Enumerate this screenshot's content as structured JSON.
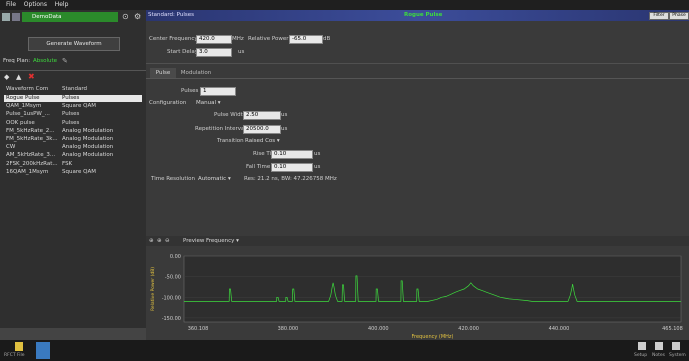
{
  "menu": {
    "items": [
      "File",
      "Options",
      "Help"
    ]
  },
  "left": {
    "project_name": "DemoData",
    "generate_label": "Generate Waveform",
    "freq_plan_label": "Freq Plan:",
    "freq_plan_value": "Absolute",
    "columns": [
      "Waveform Com",
      "Standard"
    ],
    "waveforms": [
      {
        "name": "Rogue Pulse",
        "standard": "Pulses",
        "selected": true
      },
      {
        "name": "QAM_1Msym",
        "standard": "Square QAM"
      },
      {
        "name": "Pulse_1usPW_...",
        "standard": "Pulses"
      },
      {
        "name": "OOK pulse",
        "standard": "Pulses"
      },
      {
        "name": "FM_5kHzRate_2...",
        "standard": "Analog Modulation"
      },
      {
        "name": "FM_5kHzRate_3k...",
        "standard": "Analog Modulation"
      },
      {
        "name": "CW",
        "standard": "Analog Modulation"
      },
      {
        "name": "AM_5kHzRate_3...",
        "standard": "Analog Modulation"
      },
      {
        "name": "2FSK_200kHzRat...",
        "standard": "FSK"
      },
      {
        "name": "16QAM_1Msym",
        "standard": "Square QAM"
      }
    ]
  },
  "header": {
    "standard_label": "Standard: Pulses",
    "waveform_title": "Rogue Pulse",
    "filter_button": "Filter",
    "phase_button": "Phase"
  },
  "params": {
    "center_freq_label": "Center Frequency",
    "center_freq_value": "420.0",
    "center_freq_unit": "MHz",
    "rel_power_label": "Relative Power",
    "rel_power_value": "-65.0",
    "rel_power_unit": "dB",
    "start_delay_label": "Start Delay",
    "start_delay_value": "3.0",
    "start_delay_unit": "us"
  },
  "tabs": [
    "Pulse",
    "Modulation"
  ],
  "pulse": {
    "pulses_label": "Pulses",
    "pulses_value": "1",
    "config_label": "Configuration",
    "config_value": "Manual",
    "pulse_width_label": "Pulse Width",
    "pulse_width_value": "2.50",
    "pulse_width_unit": "us",
    "rep_interval_label": "Repetition Interval",
    "rep_interval_value": "20500.0",
    "rep_interval_unit": "us",
    "transition_label": "Transition",
    "transition_value": "Raised Cos",
    "rise_label": "Rise Time",
    "rise_value": "0.10",
    "rise_unit": "us",
    "fall_label": "Fall Time",
    "fall_value": "0.10",
    "fall_unit": "us",
    "time_res_label": "Time Resolution",
    "time_res_value": "Automatic",
    "res_text": "Res: 21.2 ns, BW: 47.226758 MHz"
  },
  "preview": {
    "label": "Preview",
    "mode": "Frequency"
  },
  "chart_data": {
    "type": "line",
    "xlabel": "Frequency (MHz)",
    "ylabel": "Relative Power (dB)",
    "xlim": [
      357,
      467
    ],
    "ylim": [
      -160,
      0
    ],
    "x_ticks": [
      "360.108",
      "380.000",
      "400.000",
      "420.000",
      "440.000",
      "465.108"
    ],
    "x_tick_values": [
      360.108,
      380,
      400,
      420,
      440,
      465.108
    ],
    "y_ticks": [
      "0.00",
      "-50.00",
      "-100.00",
      "-150.00"
    ],
    "y_tick_values": [
      0,
      -50,
      -100,
      -150
    ],
    "series": [
      {
        "color": "#3ddc3d",
        "x": [
          357,
          367,
          367.05,
          367.3,
          367.55,
          368,
          377.5,
          377.55,
          377.8,
          378.05,
          379.5,
          379.55,
          379.8,
          380.05,
          381,
          381.05,
          381.3,
          381.55,
          389,
          389.5,
          389.8,
          390,
          390.2,
          390.5,
          391,
          392,
          392.05,
          392.3,
          392.55,
          395,
          395.05,
          395.3,
          395.55,
          396,
          399.5,
          399.55,
          399.8,
          400.05,
          405,
          405.05,
          405.3,
          405.55,
          406,
          408.5,
          408.55,
          408.8,
          409.05,
          411,
          413,
          414,
          415,
          416,
          417,
          418,
          419,
          420,
          420.5,
          421,
          422,
          423,
          424,
          425,
          426,
          427,
          428,
          429,
          430,
          433,
          434,
          440,
          442,
          442.5,
          442.8,
          443,
          443.2,
          443.5,
          444,
          467
        ],
        "y": [
          -110,
          -110,
          -80,
          -80,
          -110,
          -110,
          -110,
          -100,
          -100,
          -110,
          -110,
          -100,
          -100,
          -110,
          -110,
          -80,
          -80,
          -110,
          -110,
          -95,
          -75,
          -65,
          -75,
          -95,
          -110,
          -110,
          -70,
          -70,
          -110,
          -110,
          -48,
          -48,
          -110,
          -110,
          -110,
          -80,
          -80,
          -110,
          -110,
          -60,
          -60,
          -110,
          -110,
          -110,
          -80,
          -80,
          -110,
          -110,
          -105,
          -100,
          -98,
          -93,
          -88,
          -84,
          -80,
          -72,
          -65,
          -72,
          -80,
          -84,
          -88,
          -92,
          -96,
          -100,
          -102,
          -104,
          -105,
          -108,
          -110,
          -110,
          -110,
          -95,
          -80,
          -68,
          -80,
          -95,
          -110,
          -110
        ]
      }
    ]
  },
  "taskbar": {
    "left_label": "RFCT File",
    "right_labels": [
      "Setup",
      "Notes",
      "System"
    ]
  },
  "colors": {
    "accent_green": "#3ddc3d",
    "title_green": "#2d8a2d",
    "header_blue": "#2a3570"
  }
}
